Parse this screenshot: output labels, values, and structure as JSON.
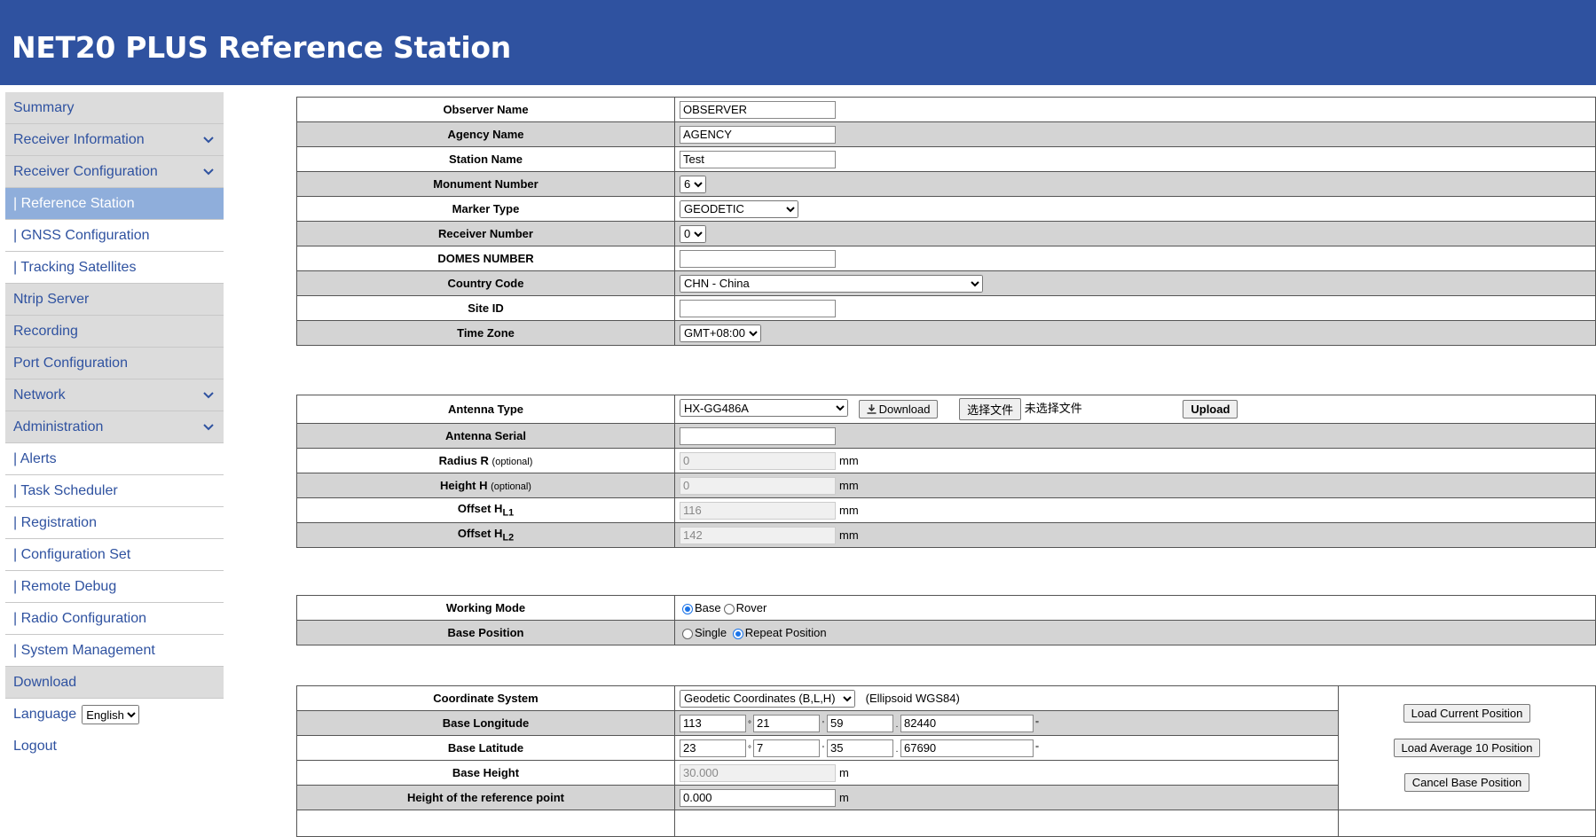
{
  "header": {
    "title": "NET20 PLUS Reference Station"
  },
  "sidebar": {
    "items": [
      {
        "label": "Summary"
      },
      {
        "label": "Receiver Information"
      },
      {
        "label": "Receiver Configuration"
      },
      {
        "label": "| Reference Station"
      },
      {
        "label": "| GNSS Configuration"
      },
      {
        "label": "| Tracking Satellites"
      },
      {
        "label": "Ntrip Server"
      },
      {
        "label": "Recording"
      },
      {
        "label": "Port Configuration"
      },
      {
        "label": "Network"
      },
      {
        "label": "Administration"
      },
      {
        "label": "| Alerts"
      },
      {
        "label": "| Task Scheduler"
      },
      {
        "label": "| Registration"
      },
      {
        "label": "| Configuration Set"
      },
      {
        "label": "| Remote Debug"
      },
      {
        "label": "| Radio Configuration"
      },
      {
        "label": "| System Management"
      },
      {
        "label": "Download"
      }
    ],
    "language_label": "Language",
    "language_value": "English",
    "logout_label": "Logout"
  },
  "station": {
    "observer_name": {
      "label": "Observer Name",
      "value": "OBSERVER"
    },
    "agency_name": {
      "label": "Agency Name",
      "value": "AGENCY"
    },
    "station_name": {
      "label": "Station Name",
      "value": "Test"
    },
    "monument_number": {
      "label": "Monument Number",
      "value": "6"
    },
    "marker_type": {
      "label": "Marker Type",
      "value": "GEODETIC"
    },
    "receiver_number": {
      "label": "Receiver Number",
      "value": "0"
    },
    "domes_number": {
      "label": "DOMES NUMBER",
      "value": ""
    },
    "country_code": {
      "label": "Country Code",
      "value": "CHN - China"
    },
    "site_id": {
      "label": "Site ID",
      "value": ""
    },
    "time_zone": {
      "label": "Time Zone",
      "value": "GMT+08:00"
    }
  },
  "antenna": {
    "type": {
      "label": "Antenna Type",
      "value": "HX-GG486A"
    },
    "download_label": "Download",
    "choose_file_label": "选择文件",
    "no_file_label": "未选择文件",
    "upload_label": "Upload",
    "serial": {
      "label": "Antenna Serial",
      "value": ""
    },
    "radius": {
      "label": "Radius R",
      "optional": "(optional)",
      "value": "0",
      "unit": "mm"
    },
    "height": {
      "label": "Height H",
      "optional": "(optional)",
      "value": "0",
      "unit": "mm"
    },
    "offset_l1": {
      "label": "Offset H",
      "sub": "L1",
      "value": "116",
      "unit": "mm"
    },
    "offset_l2": {
      "label": "Offset H",
      "sub": "L2",
      "value": "142",
      "unit": "mm"
    }
  },
  "mode": {
    "working_mode": {
      "label": "Working Mode",
      "options": [
        "Base",
        "Rover"
      ],
      "selected": "Base"
    },
    "base_position": {
      "label": "Base Position",
      "options": [
        "Single",
        "Repeat Position"
      ],
      "selected": "Repeat Position"
    }
  },
  "coords": {
    "system": {
      "label": "Coordinate System",
      "value": "Geodetic Coordinates (B,L,H)",
      "note": "(Ellipsoid WGS84)"
    },
    "longitude": {
      "label": "Base Longitude",
      "deg": "113",
      "min": "21",
      "sec": "59",
      "frac": "82440"
    },
    "latitude": {
      "label": "Base Latitude",
      "deg": "23",
      "min": "7",
      "sec": "35",
      "frac": "67690"
    },
    "height": {
      "label": "Base Height",
      "value": "30.000",
      "unit": "m"
    },
    "ref_height": {
      "label": "Height of the reference point",
      "value": "0.000",
      "unit": "m"
    },
    "deg_symbol": "°",
    "min_symbol": "'",
    "sec_symbol": "\"",
    "dot": ".",
    "buttons": {
      "load_current": "Load Current Position",
      "load_average": "Load Average 10 Position",
      "cancel": "Cancel Base Position"
    }
  }
}
